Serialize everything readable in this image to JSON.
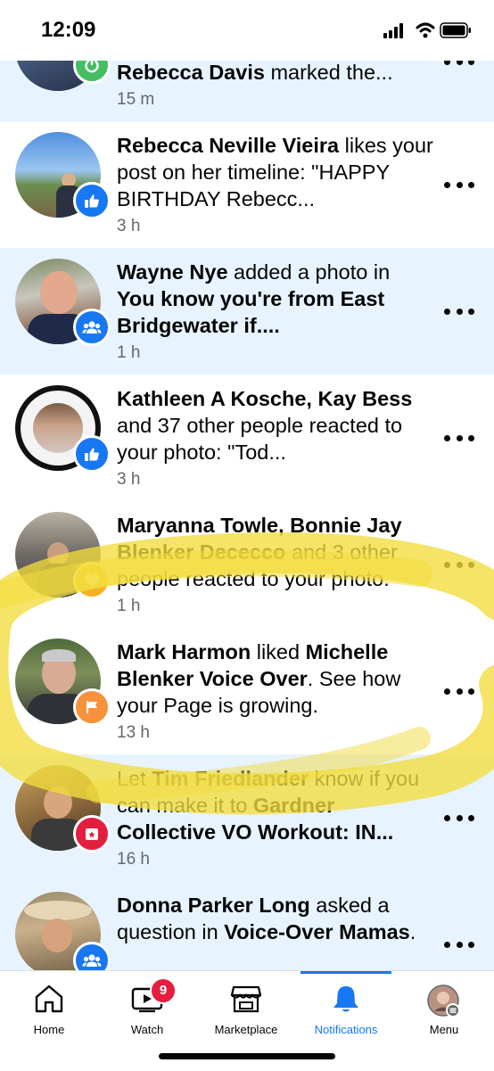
{
  "status_bar": {
    "time": "12:09",
    "signal_icon": "signal-bars-icon",
    "wifi_icon": "wifi-icon",
    "battery_icon": "battery-icon"
  },
  "notifications": [
    {
      "segments": [
        {
          "t": "Rebecca Davis",
          "b": true
        },
        {
          "t": " marked the...",
          "b": false
        }
      ],
      "time": "15 m",
      "badge_icon": "power-icon",
      "badge_color": "#45bd62",
      "unread": true
    },
    {
      "segments": [
        {
          "t": "Rebecca Neville Vieira",
          "b": true
        },
        {
          "t": " likes your post on her timeline: \"HAPPY BIRTHDAY Rebecc...",
          "b": false
        }
      ],
      "time": "3 h",
      "badge_icon": "thumbs-up-icon",
      "badge_color": "#1877f2",
      "unread": false
    },
    {
      "segments": [
        {
          "t": "Wayne Nye",
          "b": true
        },
        {
          "t": " added a photo in ",
          "b": false
        },
        {
          "t": "You know you're from East Bridgewater if....",
          "b": true
        }
      ],
      "time": "1 h",
      "badge_icon": "group-icon",
      "badge_color": "#1877f2",
      "unread": true
    },
    {
      "segments": [
        {
          "t": "Kathleen A Kosche, Kay Bess",
          "b": true
        },
        {
          "t": " and 37 other people reacted to your photo: \"Tod...",
          "b": false
        }
      ],
      "time": "3 h",
      "badge_icon": "thumbs-up-icon",
      "badge_color": "#1877f2",
      "unread": false
    },
    {
      "segments": [
        {
          "t": "Maryanna Towle, Bonnie Jay Blenker Dececco",
          "b": true
        },
        {
          "t": " and 3 other people reacted to your photo.",
          "b": false
        }
      ],
      "time": "1 h",
      "badge_icon": "heart-icon",
      "badge_color": "#f7b125",
      "unread": false
    },
    {
      "segments": [
        {
          "t": "Mark Harmon",
          "b": true
        },
        {
          "t": " liked ",
          "b": false
        },
        {
          "t": "Michelle Blenker Voice Over",
          "b": true
        },
        {
          "t": ". See how your Page is growing.",
          "b": false
        }
      ],
      "time": "13 h",
      "badge_icon": "flag-icon",
      "badge_color": "#f7923a",
      "unread": false
    },
    {
      "segments": [
        {
          "t": "Let ",
          "b": false
        },
        {
          "t": "Tim Friedlander",
          "b": true
        },
        {
          "t": " know if you can make it to ",
          "b": false
        },
        {
          "t": "Gardner Collective VO Workout: IN...",
          "b": true
        }
      ],
      "time": "16 h",
      "badge_icon": "calendar-star-icon",
      "badge_color": "#e41e3f",
      "unread": true
    },
    {
      "segments": [
        {
          "t": "Donna Parker Long",
          "b": true
        },
        {
          "t": " asked a question in ",
          "b": false
        },
        {
          "t": "Voice-Over Mamas",
          "b": true
        },
        {
          "t": ".",
          "b": false
        }
      ],
      "time": "",
      "badge_icon": "group-icon",
      "badge_color": "#1877f2",
      "unread": true
    }
  ],
  "tabs": [
    {
      "label": "Home",
      "icon": "home-icon",
      "active": false
    },
    {
      "label": "Watch",
      "icon": "watch-video-icon",
      "active": false,
      "badge": "9"
    },
    {
      "label": "Marketplace",
      "icon": "marketplace-store-icon",
      "active": false
    },
    {
      "label": "Notifications",
      "icon": "bell-icon",
      "active": true
    },
    {
      "label": "Menu",
      "icon": "profile-avatar-icon",
      "active": false
    }
  ],
  "colors": {
    "accent": "#1877f2",
    "unread_bg": "#e7f3ff",
    "secondary_text": "#65676b",
    "highlighter": "#f2dc3c"
  }
}
